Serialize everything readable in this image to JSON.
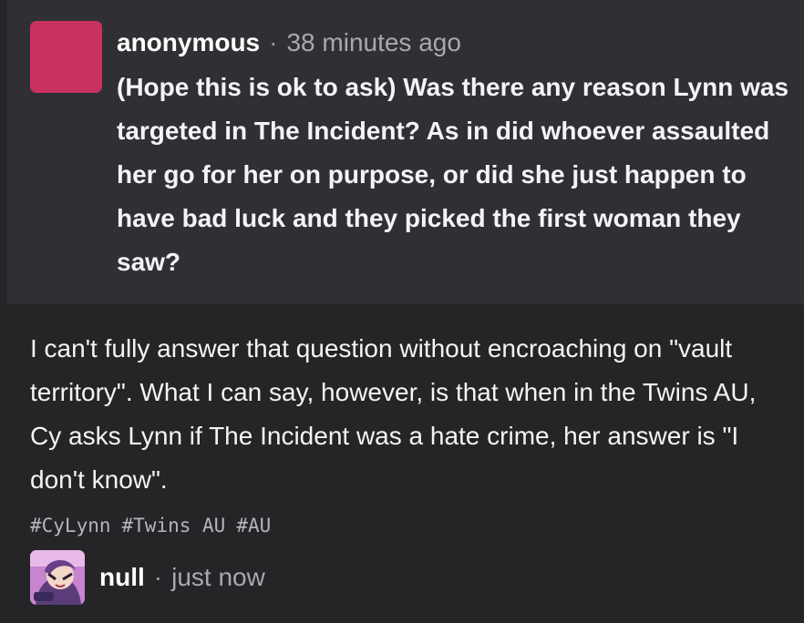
{
  "ask": {
    "author": "anonymous",
    "separator": "·",
    "time": "38 minutes ago",
    "question": "(Hope this is ok to ask) Was there any reason Lynn was targeted in The Incident? As in did whoever assaulted her go for her on purpose, or did she just happen to have bad luck and they picked the first woman they saw?",
    "avatar_color": "#c8325f"
  },
  "answer": {
    "text": "I can't fully answer that question without encroaching on \"vault territory\". What I can say, however, is that when in the Twins AU, Cy asks Lynn if The Incident was a hate crime, her answer is \"I don't know\".",
    "tags": [
      "#CyLynn",
      "#Twins AU",
      "#AU"
    ]
  },
  "footer": {
    "author": "null",
    "separator": "·",
    "time": "just now"
  },
  "colors": {
    "background": "#252528",
    "ask_box": "#303034",
    "accent_avatar": "#c8325f"
  }
}
